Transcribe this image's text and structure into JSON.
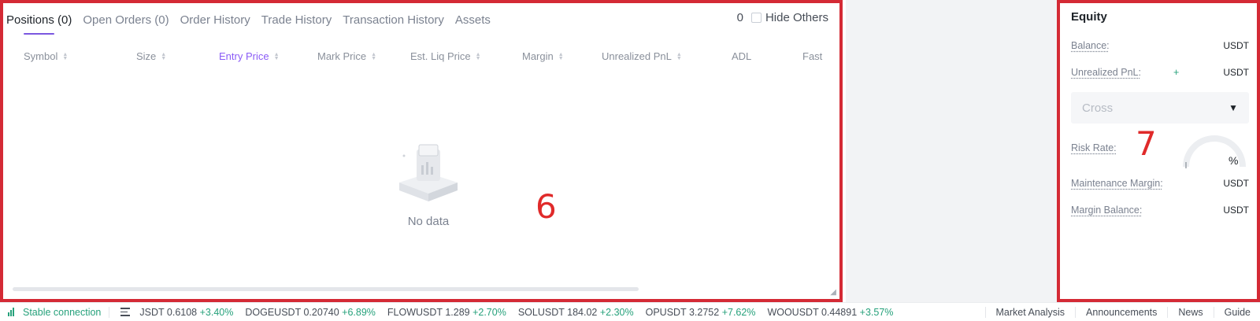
{
  "positions_panel": {
    "tabs": [
      {
        "label": "Positions (0)",
        "active": true
      },
      {
        "label": "Open Orders (0)"
      },
      {
        "label": "Order History"
      },
      {
        "label": "Trade History"
      },
      {
        "label": "Transaction History"
      },
      {
        "label": "Assets"
      }
    ],
    "count": "0",
    "hide_others_label": "Hide Others",
    "columns": [
      "Symbol",
      "Size",
      "Entry Price",
      "Mark Price",
      "Est. Liq Price",
      "Margin",
      "Unrealized PnL",
      "ADL",
      "Fast"
    ],
    "empty_text": "No data",
    "annotation": "6"
  },
  "equity_panel": {
    "title": "Equity",
    "balance_label": "Balance:",
    "balance_unit": "USDT",
    "unrealized_label": "Unrealized PnL:",
    "unrealized_sign": "+",
    "unrealized_unit": "USDT",
    "margin_mode": "Cross",
    "risk_label": "Risk Rate:",
    "risk_unit": "%",
    "maintenance_label": "Maintenance Margin:",
    "maintenance_unit": "USDT",
    "margin_balance_label": "Margin Balance:",
    "margin_balance_unit": "USDT",
    "annotation": "7"
  },
  "status_bar": {
    "connection": "Stable connection",
    "tickers": [
      {
        "symbol": "JSDT",
        "price": "0.6108",
        "change": "+3.40%"
      },
      {
        "symbol": "DOGEUSDT",
        "price": "0.20740",
        "change": "+6.89%"
      },
      {
        "symbol": "FLOWUSDT",
        "price": "1.289",
        "change": "+2.70%"
      },
      {
        "symbol": "SOLUSDT",
        "price": "184.02",
        "change": "+2.30%"
      },
      {
        "symbol": "OPUSDT",
        "price": "3.2752",
        "change": "+7.62%"
      },
      {
        "symbol": "WOOUSDT",
        "price": "0.44891",
        "change": "+3.57%"
      }
    ],
    "links": [
      "Market Analysis",
      "Announcements",
      "News",
      "Guide"
    ]
  },
  "colors": {
    "annotation_red": "#d42a35",
    "accent_purple": "#8b5cf6",
    "positive_green": "#26a17b"
  }
}
